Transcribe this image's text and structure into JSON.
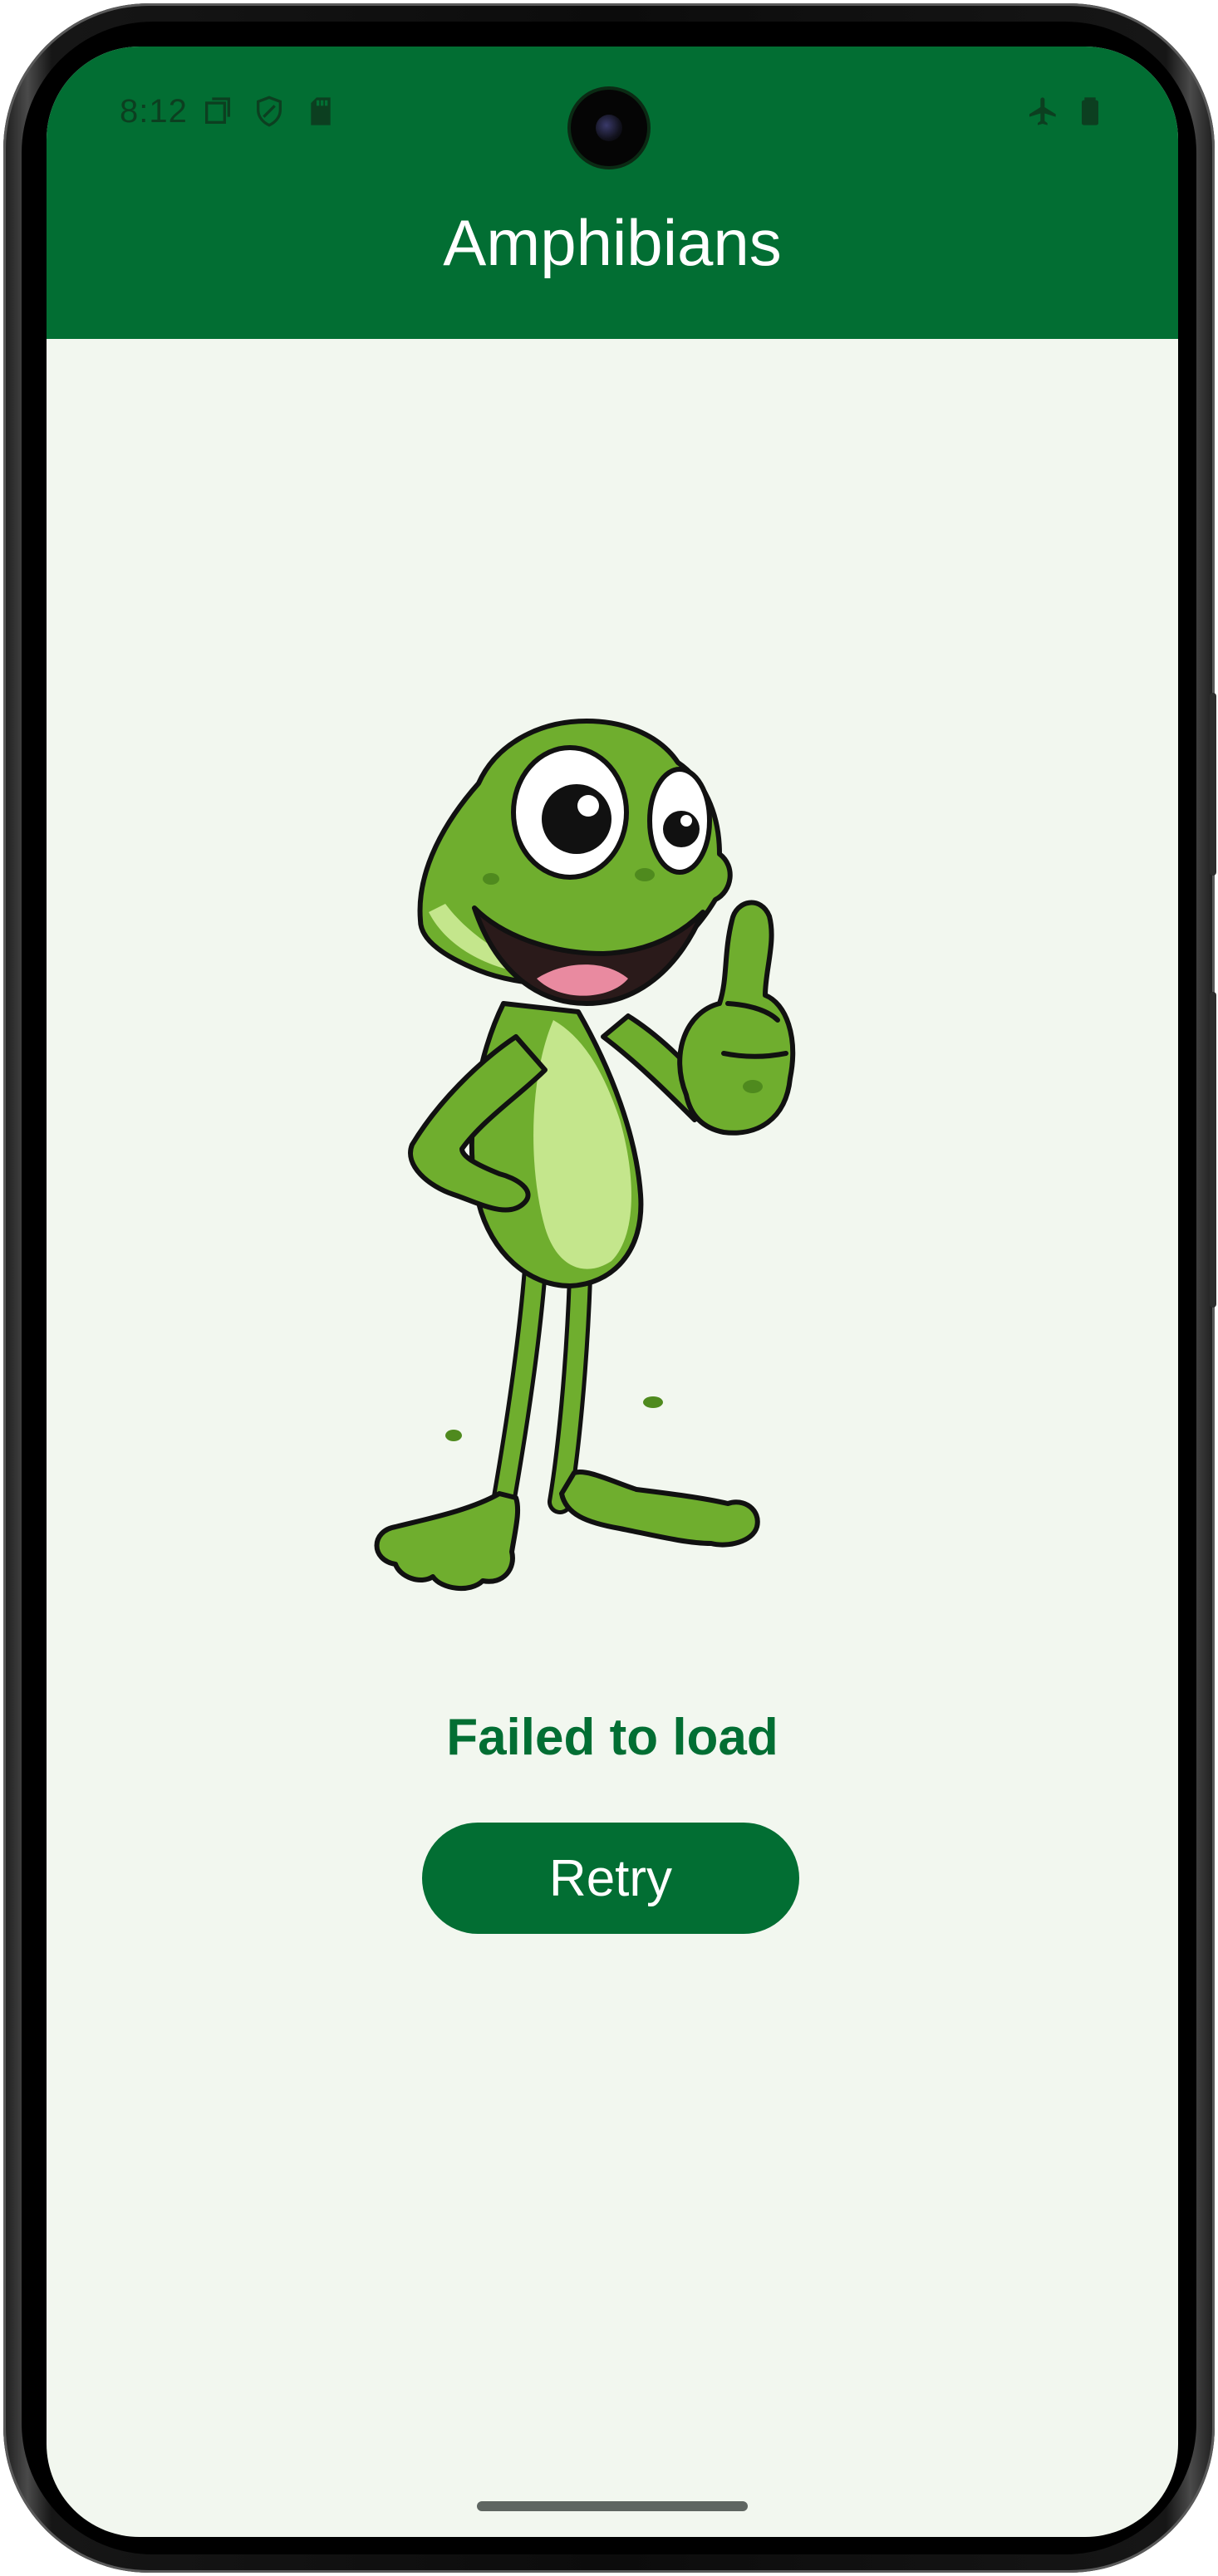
{
  "status_bar": {
    "time": "8:12",
    "left_icons": [
      "screen-record-icon",
      "shield-icon",
      "sd-card-icon"
    ],
    "right_icons": [
      "airplane-mode-icon",
      "battery-icon"
    ]
  },
  "app_bar": {
    "title": "Amphibians"
  },
  "main": {
    "illustration": "frog-thumbs-up-illustration",
    "error_message": "Failed to load",
    "retry_label": "Retry"
  },
  "colors": {
    "primary": "#026e33",
    "background": "#f2f7ef",
    "on_primary": "#ffffff",
    "frog_green": "#6fae2e",
    "frog_light": "#c4e68c"
  }
}
